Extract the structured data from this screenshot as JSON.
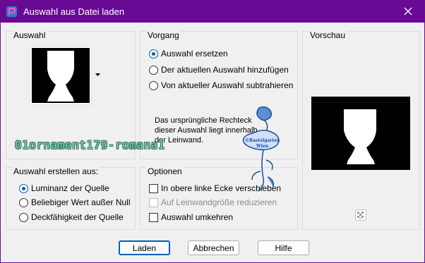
{
  "window": {
    "title": "Auswahl aus Datei laden"
  },
  "auswahl": {
    "title": "Auswahl"
  },
  "vorgang": {
    "title": "Vorgang",
    "options": [
      {
        "label": "Auswahl ersetzen",
        "checked": true
      },
      {
        "label": "Der aktuellen Auswahl hinzufügen",
        "checked": false
      },
      {
        "label": "Von aktueller Auswahl subtrahieren",
        "checked": false
      }
    ],
    "description": "Das ursprüngliche Rechteck dieser Auswahl liegt innerhalb der Leinwand."
  },
  "vorschau": {
    "title": "Vorschau"
  },
  "erstellen": {
    "title": "Auswahl erstellen aus:",
    "options": [
      {
        "label": "Luminanz der Quelle",
        "checked": true
      },
      {
        "label": "Beliebiger Wert außer Null",
        "checked": false
      },
      {
        "label": "Deckfähigkeit der Quelle",
        "checked": false
      }
    ]
  },
  "optionen": {
    "title": "Optionen",
    "items": [
      {
        "label": "In obere linke Ecke verschieben",
        "checked": false,
        "disabled": false
      },
      {
        "label": "Auf Leinwandgröße reduzieren",
        "checked": false,
        "disabled": true
      },
      {
        "label": "Auswahl umkehren",
        "checked": false,
        "disabled": false
      }
    ]
  },
  "buttons": {
    "ok": "Laden",
    "cancel": "Abbrechen",
    "help": "Hilfe"
  },
  "overlay": {
    "file_name": "01ornament179-romana1",
    "stamp_line1": "©Bastelgarten",
    "stamp_line2": "Wien"
  },
  "colors": {
    "titlebar": "#680a95",
    "accent": "#005fb8"
  }
}
